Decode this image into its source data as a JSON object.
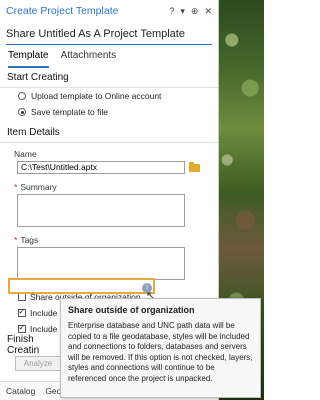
{
  "window": {
    "title": "Create Project Template",
    "controls": [
      "?",
      "▾",
      "⊕",
      "✕"
    ]
  },
  "header": {
    "subtitle": "Share Untitled As A Project Template"
  },
  "tabs": [
    {
      "label": "Template"
    },
    {
      "label": "Attachments"
    }
  ],
  "start_creating": {
    "heading": "Start Creating",
    "options": [
      {
        "label": "Upload template to Online account",
        "selected": false
      },
      {
        "label": "Save template to file",
        "selected": true
      }
    ]
  },
  "item_details": {
    "heading": "Item Details",
    "name_label": "Name",
    "name_value": "C:\\Test\\Untitled.aptx",
    "summary_label": "Summary",
    "tags_label": "Tags"
  },
  "checkboxes": [
    {
      "label": "Share outside of organization",
      "checked": false
    },
    {
      "label": "Include To",
      "checked": true
    },
    {
      "label": "Include H",
      "checked": true
    }
  ],
  "finish": {
    "heading": "Finish Creatin",
    "analyze_label": "Analyze"
  },
  "bottom_tabs": [
    "Catalog",
    "Geopr"
  ],
  "tooltip": {
    "title": "Share outside of organization",
    "body": "Enterprise database and UNC path data will be copied to a file geodatabase, styles will be included and connections to folders, databases and servers will be removed. If this option is not checked, layers, styles and connections will continue to be referenced once the project is unpacked."
  },
  "colors": {
    "accent": "#2b74c4",
    "highlight": "#e7a93b",
    "folder": "#e2a92b"
  }
}
